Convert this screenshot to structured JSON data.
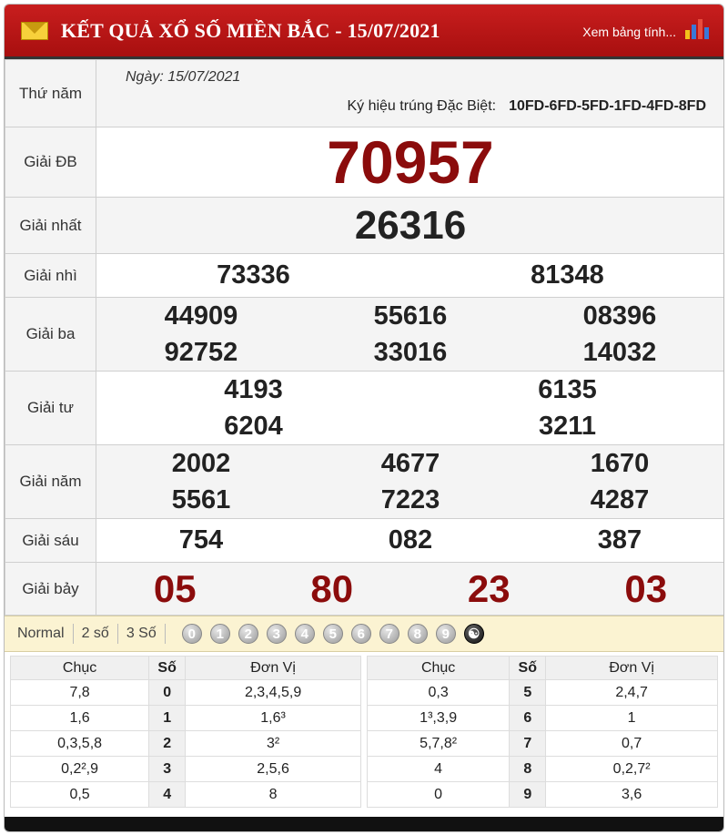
{
  "header": {
    "title": "KẾT QUẢ XỔ SỐ MIỀN BẮC - 15/07/2021",
    "view_link": "Xem bảng tính...",
    "colors": {
      "header_bg": "#b81515",
      "special_prize": "#8b0c0c"
    }
  },
  "info": {
    "weekday": "Thứ năm",
    "date_label": "Ngày: 15/07/2021",
    "code_label": "Ký hiệu trúng Đặc Biệt:",
    "code_value": "10FD-6FD-5FD-1FD-4FD-8FD"
  },
  "prizes": {
    "db": {
      "label": "Giải ĐB",
      "numbers": [
        "70957"
      ]
    },
    "g1": {
      "label": "Giải nhất",
      "numbers": [
        "26316"
      ]
    },
    "g2": {
      "label": "Giải nhì",
      "numbers": [
        "73336",
        "81348"
      ]
    },
    "g3": {
      "label": "Giải ba",
      "numbers": [
        "44909",
        "55616",
        "08396",
        "92752",
        "33016",
        "14032"
      ]
    },
    "g4": {
      "label": "Giải tư",
      "numbers": [
        "4193",
        "6135",
        "6204",
        "3211"
      ]
    },
    "g5": {
      "label": "Giải năm",
      "numbers": [
        "2002",
        "4677",
        "1670",
        "5561",
        "7223",
        "4287"
      ]
    },
    "g6": {
      "label": "Giải sáu",
      "numbers": [
        "754",
        "082",
        "387"
      ]
    },
    "g7": {
      "label": "Giải bảy",
      "numbers": [
        "05",
        "80",
        "23",
        "03"
      ]
    }
  },
  "filters": {
    "tabs": [
      "Normal",
      "2 số",
      "3 Số"
    ],
    "digits": [
      "0",
      "1",
      "2",
      "3",
      "4",
      "5",
      "6",
      "7",
      "8",
      "9"
    ]
  },
  "stats": {
    "headers": {
      "chuc": "Chục",
      "so": "Số",
      "donvi": "Đơn Vị"
    },
    "left": [
      {
        "chuc": "7,8",
        "so": "0",
        "donvi": "2,3,4,5,9"
      },
      {
        "chuc": "1,6",
        "so": "1",
        "donvi": "1,6³"
      },
      {
        "chuc": "0,3,5,8",
        "so": "2",
        "donvi": "3²"
      },
      {
        "chuc": "0,2²,9",
        "so": "3",
        "donvi": "2,5,6"
      },
      {
        "chuc": "0,5",
        "so": "4",
        "donvi": "8"
      }
    ],
    "right": [
      {
        "chuc": "0,3",
        "so": "5",
        "donvi": "2,4,7"
      },
      {
        "chuc": "1³,3,9",
        "so": "6",
        "donvi": "1"
      },
      {
        "chuc": "5,7,8²",
        "so": "7",
        "donvi": "0,7"
      },
      {
        "chuc": "4",
        "so": "8",
        "donvi": "0,2,7²"
      },
      {
        "chuc": "0",
        "so": "9",
        "donvi": "3,6"
      }
    ]
  }
}
